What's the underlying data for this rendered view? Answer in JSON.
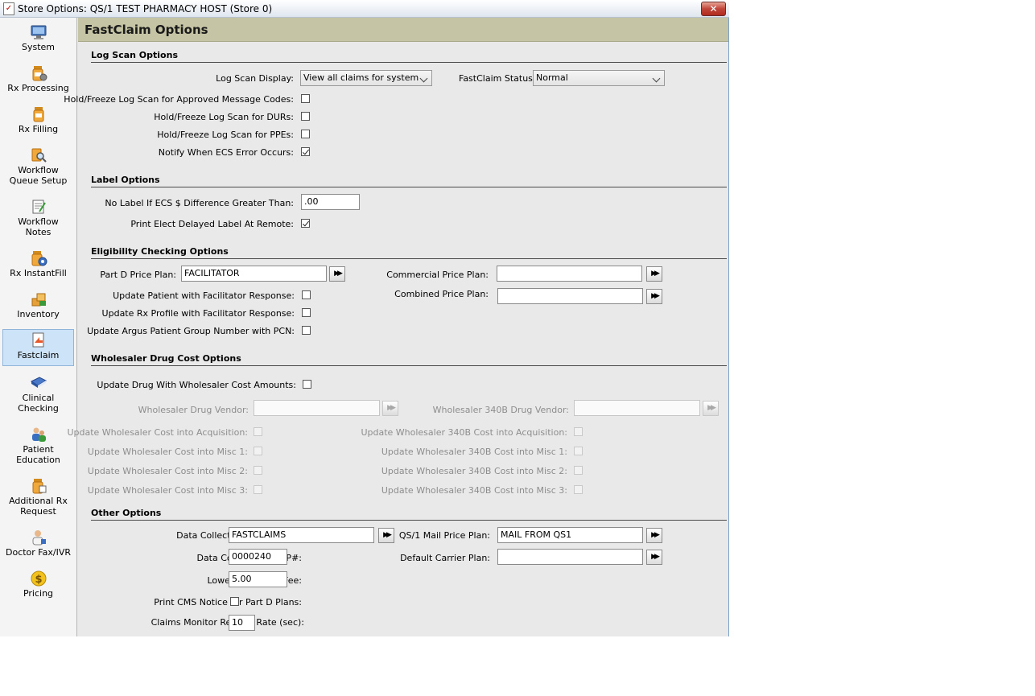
{
  "window": {
    "title": "Store Options: QS/1 TEST PHARMACY HOST (Store 0)",
    "close_glyph": "✕"
  },
  "sidebar": {
    "items": [
      {
        "label": "System",
        "icon": "monitor-icon"
      },
      {
        "label": "Rx Processing",
        "icon": "pill-bottle-gear-icon"
      },
      {
        "label": "Rx Filling",
        "icon": "pill-bottle-icon"
      },
      {
        "label": "Workflow Queue Setup",
        "line1": "Workflow",
        "line2": "Queue Setup",
        "icon": "workflow-search-icon"
      },
      {
        "label": "Workflow Notes",
        "line1": "Workflow",
        "line2": "Notes",
        "icon": "notes-icon"
      },
      {
        "label": "Rx InstantFill",
        "icon": "instantfill-icon"
      },
      {
        "label": "Inventory",
        "icon": "inventory-icon"
      },
      {
        "label": "Fastclaim",
        "icon": "fastclaim-icon",
        "active": true
      },
      {
        "label": "Clinical Checking",
        "line1": "Clinical",
        "line2": "Checking",
        "icon": "clinical-book-icon"
      },
      {
        "label": "Patient Education",
        "line1": "Patient",
        "line2": "Education",
        "icon": "patient-people-icon"
      },
      {
        "label": "Additional Rx Request",
        "line1": "Additional Rx",
        "line2": "Request",
        "icon": "additional-rx-icon"
      },
      {
        "label": "Doctor Fax/IVR",
        "icon": "doctor-icon"
      },
      {
        "label": "Pricing",
        "icon": "dollar-coin-icon"
      }
    ]
  },
  "header": {
    "title": "FastClaim Options"
  },
  "log_scan": {
    "section": "Log Scan Options",
    "display_label": "Log Scan Display:",
    "display_value": "View all claims for system",
    "status_label": "FastClaim Status:",
    "status_value": "Normal",
    "hold_approved_label": "Hold/Freeze Log Scan for Approved Message Codes:",
    "hold_approved": false,
    "hold_durs_label": "Hold/Freeze Log Scan for DURs:",
    "hold_durs": false,
    "hold_ppes_label": "Hold/Freeze Log Scan for PPEs:",
    "hold_ppes": false,
    "notify_label": "Notify When ECS Error Occurs:",
    "notify": true
  },
  "label_options": {
    "section": "Label Options",
    "no_label_label": "No Label If ECS $ Difference Greater Than:",
    "no_label_value": ".00",
    "print_delayed_label": "Print Elect Delayed Label At Remote:",
    "print_delayed": true
  },
  "eligibility": {
    "section": "Eligibility Checking Options",
    "partd_label": "Part D Price Plan:",
    "partd_value": "FACILITATOR",
    "commercial_label": "Commercial Price Plan:",
    "commercial_value": "",
    "combined_label": "Combined Price Plan:",
    "combined_value": "",
    "update_patient_label": "Update Patient with Facilitator Response:",
    "update_rx_label": "Update Rx Profile with Facilitator Response:",
    "update_argus_label": "Update Argus Patient Group Number with PCN:"
  },
  "wholesaler": {
    "section": "Wholesaler Drug Cost Options",
    "update_drug_label": "Update Drug With Wholesaler Cost Amounts:",
    "vendor_label": "Wholesaler Drug Vendor:",
    "vendor340_label": "Wholesaler 340B Drug Vendor:",
    "acq_label": "Update Wholesaler Cost into Acquisition:",
    "misc1_label": "Update Wholesaler Cost into Misc 1:",
    "misc2_label": "Update Wholesaler Cost into Misc 2:",
    "misc3_label": "Update Wholesaler Cost into Misc 3:",
    "acq340_label": "Update Wholesaler 340B Cost into Acquisition:",
    "misc1_340_label": "Update Wholesaler 340B Cost into Misc 1:",
    "misc2_340_label": "Update Wholesaler 340B Cost into Misc 2:",
    "misc3_340_label": "Update Wholesaler 340B Cost into Misc 3:"
  },
  "other": {
    "section": "Other Options",
    "carrier_label": "Data Collection Carrier Plan:",
    "carrier_value": "FASTCLAIMS",
    "nabp_label": "Data Collection NABP#:",
    "nabp_value": "0000240",
    "medicaid_label": "Lowest Medicaid Fee:",
    "medicaid_value": "5.00",
    "cms_label": "Print CMS Notice for Part D Plans:",
    "refresh_label": "Claims Monitor Refresh Rate (sec):",
    "refresh_value": "10",
    "mail_label": "QS/1 Mail Price Plan:",
    "mail_value": "MAIL FROM QS1",
    "default_carrier_label": "Default Carrier Plan:",
    "default_carrier_value": ""
  },
  "lookup_glyph": "▶▶",
  "colors": {
    "header_bg": "#c5c4a4",
    "active_nav": "#cde3f7",
    "window_bg": "#e9e9e9"
  }
}
